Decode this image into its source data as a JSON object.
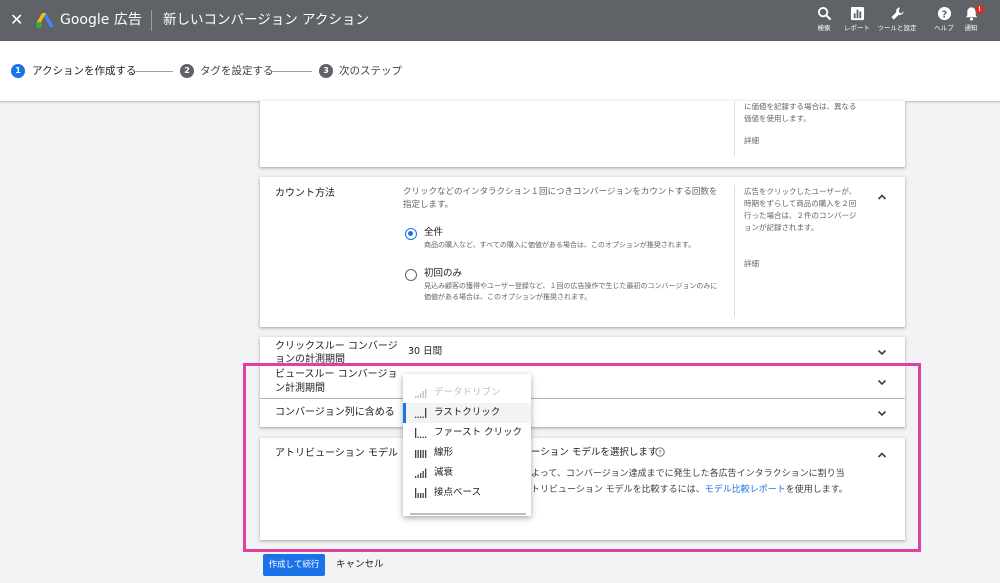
{
  "header": {
    "brand": "Google 広告",
    "title": "新しいコンバージョン アクション",
    "tools": [
      {
        "icon": "search-icon",
        "label": "検索"
      },
      {
        "icon": "reports-icon",
        "label": "レポート"
      },
      {
        "icon": "wrench-icon",
        "label": "ツールと設定"
      },
      {
        "icon": "help-icon",
        "label": "ヘルプ"
      },
      {
        "icon": "bell-icon",
        "label": "通知"
      }
    ],
    "notification_badge": "!",
    "colors": {
      "bar": "#5f6368"
    }
  },
  "stepper": {
    "steps": [
      {
        "number": "1",
        "label": "アクションを作成する",
        "state": "active"
      },
      {
        "number": "2",
        "label": "タグを設定する",
        "state": "inactive"
      },
      {
        "number": "3",
        "label": "次のステップ",
        "state": "inactive"
      }
    ],
    "colors": {
      "active": "#1a73e8",
      "inactive": "#5f6368"
    }
  },
  "top_card": {
    "side_text": "に価値を記録する場合は、異なる価値を使用します。",
    "side_link": "詳細"
  },
  "counting": {
    "title": "カウント方法",
    "description": "クリックなどのインタラクション１回につきコンバージョンをカウントする回数を指定します。",
    "options": [
      {
        "label": "全件",
        "description": "商品の購入など、すべての購入に価値がある場合は、このオプションが推奨されます。",
        "selected": true
      },
      {
        "label": "初回のみ",
        "description": "見込み顧客の獲得やユーザー登録など、１回の広告操作で生じた最初のコンバージョンのみに価値がある場合は、このオプションが推奨されます。",
        "selected": false
      }
    ],
    "side_text": "広告をクリックしたユーザーが、時期をずらして商品の購入を２回行った場合は、２件のコンバージョンが記録されます。",
    "side_link": "詳細"
  },
  "click_through": {
    "title": "クリックスルー コンバージョンの計測期間",
    "value": "30 日間"
  },
  "view_through": {
    "title": "ビュースルー コンバージョン計測期間"
  },
  "include_in_conversions": {
    "title": "コンバージョン列に含める"
  },
  "attribution": {
    "title": "アトリビューション モデル",
    "subtitle": "ーション モデルを選択します",
    "body_line1": "よって、コンバージョン達成までに発生した各広告インタラクションに割り当",
    "body_line2_prefix": "トリビューション モデルを比較するには、",
    "body_link": "モデル比較レポート",
    "body_line2_suffix": "を使用します。"
  },
  "dropdown": {
    "items": [
      {
        "label": "データドリブン",
        "icon": "data-driven-icon",
        "state": "disabled"
      },
      {
        "label": "ラストクリック",
        "icon": "last-click-icon",
        "state": "selected"
      },
      {
        "label": "ファースト クリック",
        "icon": "first-click-icon",
        "state": "normal"
      },
      {
        "label": "線形",
        "icon": "linear-icon",
        "state": "normal"
      },
      {
        "label": "減衰",
        "icon": "time-decay-icon",
        "state": "normal"
      },
      {
        "label": "接点ベース",
        "icon": "position-based-icon",
        "state": "normal"
      }
    ]
  },
  "actions": {
    "primary": "作成して続行",
    "cancel": "キャンセル"
  },
  "annotation": {
    "color": "#e040a0"
  }
}
